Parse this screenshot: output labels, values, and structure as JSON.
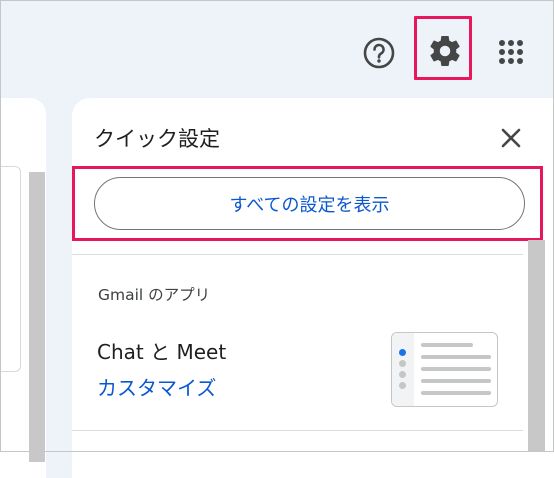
{
  "topbar": {
    "icons": {
      "help": "help-circle-icon",
      "settings": "gear-icon",
      "apps": "apps-grid-icon"
    }
  },
  "quick_settings": {
    "title": "クイック設定",
    "close_icon": "close-icon",
    "see_all_button": "すべての設定を表示",
    "sections": [
      {
        "title": "Gmail のアプリ",
        "item_label": "Chat と Meet",
        "item_action": "カスタマイズ"
      }
    ]
  },
  "colors": {
    "highlight": "#e8175d",
    "link": "#0b57d0",
    "background": "#eef2f9"
  }
}
